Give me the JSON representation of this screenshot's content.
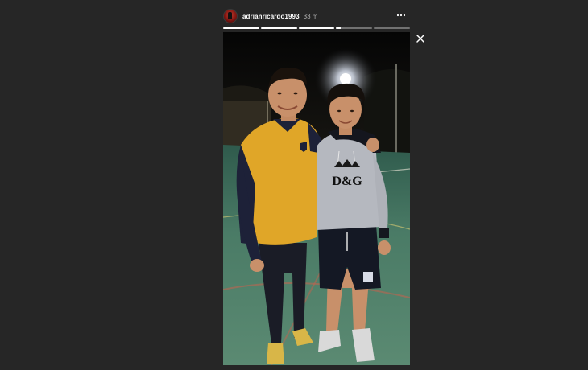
{
  "story": {
    "username": "adrianricardo1993",
    "timestamp": "33 m",
    "progress": [
      1,
      1,
      1,
      0.12,
      0
    ],
    "photo_text": "D&G"
  },
  "icons": {
    "more": "more-horizontal-icon",
    "close": "close-icon"
  },
  "colors": {
    "background": "#262626",
    "text": "#ffffff",
    "muted": "#b5b5b5",
    "court": "#3f6e5c",
    "jersey_gold": "#e0a628"
  }
}
